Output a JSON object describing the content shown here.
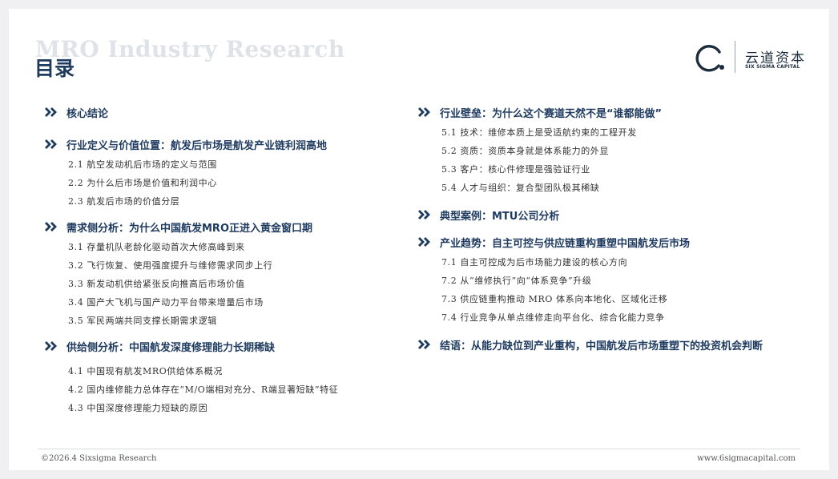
{
  "header": {
    "background_title": "MRO Industry Research",
    "title": "目录"
  },
  "logo": {
    "cn": "云道资本",
    "en": "SIX SIGMA CAPITAL"
  },
  "toc_left": {
    "s0": {
      "title": "核心结论"
    },
    "s1": {
      "title": "行业定义与价值位置：航发后市场是航发产业链利润高地",
      "items": [
        "2.1 航空发动机后市场的定义与范围",
        "2.2 为什么后市场是价值和利润中心",
        "2.3 航发后市场的价值分层"
      ]
    },
    "s2": {
      "title": "需求侧分析：为什么中国航发MRO正进入黄金窗口期",
      "items": [
        "3.1 存量机队老龄化驱动首次大修高峰到来",
        "3.2 飞行恢复、使用强度提升与维修需求同步上行",
        "3.3 新发动机供给紧张反向推高后市场价值",
        "3.4 国产大飞机与国产动力平台带来增量后市场",
        "3.5 军民两端共同支撑长期需求逻辑"
      ]
    },
    "s3": {
      "title": "供给侧分析：中国航发深度修理能力长期稀缺",
      "items": [
        "4.1 中国现有航发MRO供给体系概况",
        "4.2 国内维修能力总体存在“M/O端相对充分、R端显著短缺”特征",
        "4.3 中国深度修理能力短缺的原因"
      ]
    }
  },
  "toc_right": {
    "s4": {
      "title": "行业壁垒：为什么这个赛道天然不是“谁都能做”",
      "items": [
        "5.1 技术：维修本质上是受适航约束的工程开发",
        "5.2 资质：资质本身就是体系能力的外显",
        "5.3 客户：核心件修理是强验证行业",
        "5.4 人才与组织：复合型团队极其稀缺"
      ]
    },
    "s5": {
      "title": "典型案例：MTU公司分析"
    },
    "s6": {
      "title": "产业趋势：自主可控与供应链重构重塑中国航发后市场",
      "items": [
        "7.1 自主可控成为后市场能力建设的核心方向",
        "7.2 从“维修执行”向“体系竞争”升级",
        "7.3 供应链重构推动 MRO 体系向本地化、区域化迁移",
        "7.4 行业竞争从单点维修走向平台化、综合化能力竞争"
      ]
    },
    "s7": {
      "title": "结语：从能力缺位到产业重构，中国航发后市场重塑下的投资机会判断"
    }
  },
  "footer": {
    "copyright": "©2026.4 Sixsigma Research",
    "website": "www.6sigmacapital.com"
  },
  "colors": {
    "navy": "#1e3a5f",
    "text": "#333333",
    "watermark": "#dfe3e8"
  },
  "icons": {
    "section_marker": "double-chevron-right-icon"
  }
}
